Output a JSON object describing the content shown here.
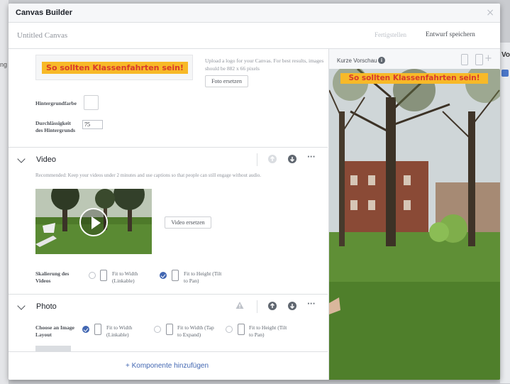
{
  "background": {
    "left_text": "ng",
    "right_text": "Vo"
  },
  "modal": {
    "title": "Canvas Builder",
    "close_symbol": "×"
  },
  "canvas_bar": {
    "name": "Untitled Canvas",
    "finish": "Fertigstellen",
    "save_draft": "Entwurf speichern"
  },
  "header_component": {
    "logo_text": "So sollten Klassenfahrten sein!",
    "upload_hint": "Upload a logo for your Canvas. For best results, images should be 882 x 66 pixels",
    "photo_replace": "Foto ersetzen",
    "background_color_label": "Hintergrundfarbe",
    "background_opacity_label_1": "Durchlässigkeit",
    "background_opacity_label_2": "des Hintergrunds",
    "background_opacity_value": "75"
  },
  "video_section": {
    "title": "Video",
    "recommendation": "Recommended: Keep your videos under 2 minutes and use captions so that people can still engage without audio.",
    "replace": "Video ersetzen",
    "scale_label_1": "Skalierung des",
    "scale_label_2": "Videos",
    "option_fit_width_1": "Fit to Width",
    "option_fit_width_2": "(Linkable)",
    "option_fit_height_1": "Fit to Height (Tilt",
    "option_fit_height_2": "to Pan)",
    "selected": "fit-to-height"
  },
  "photo_section": {
    "title": "Photo",
    "layout_label_1": "Choose an Image",
    "layout_label_2": "Layout",
    "option1_1": "Fit to Width",
    "option1_2": "(Linkable)",
    "option2_1": "Fit to Width (Tap",
    "option2_2": "to Expand)",
    "option3_1": "Fit to Height (Tilt",
    "option3_2": "to Pan)",
    "selected": "fit-to-width-linkable"
  },
  "footer": {
    "add_component": "+ Komponente hinzufügen"
  },
  "preview": {
    "label": "Kurze Vorschau",
    "info_symbol": "i",
    "plus_symbol": "+",
    "banner_text": "So sollten Klassenfahrten sein!"
  },
  "colors": {
    "accent": "#4267b2",
    "banner_bg": "#f7b928",
    "banner_text": "#d93a2b"
  },
  "icons": [
    "close-icon",
    "chevron-down-icon",
    "arrow-up-icon",
    "arrow-down-icon",
    "more-icon",
    "warning-icon",
    "play-icon",
    "info-icon",
    "phone-icon",
    "tablet-icon"
  ]
}
